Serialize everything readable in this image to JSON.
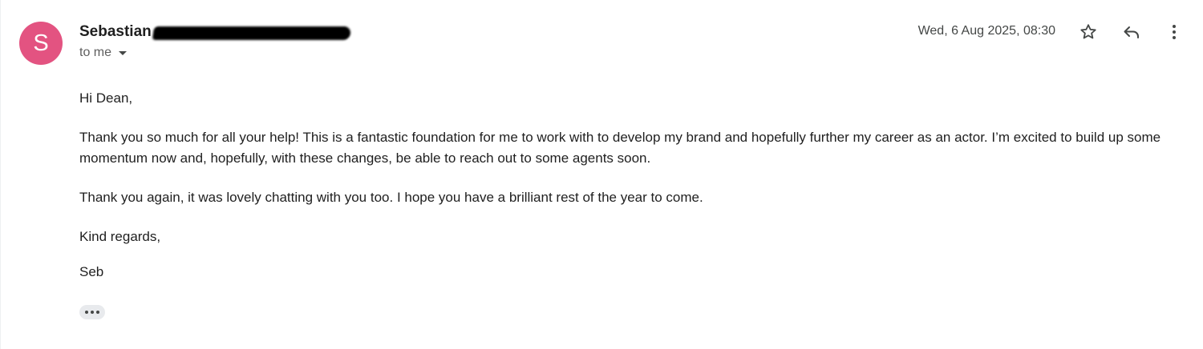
{
  "sender": {
    "avatar_letter": "S",
    "avatar_color": "#e35381",
    "name": "Sebastian"
  },
  "recipient": {
    "label": "to me"
  },
  "date": "Wed, 6 Aug 2025, 08:30",
  "actions": {
    "star_icon": "star-outline-icon",
    "reply_icon": "reply-arrow-icon",
    "more_icon": "vertical-dots-icon"
  },
  "message": {
    "greeting": "Hi Dean,",
    "paragraph_1": "Thank you so much for all your help! This is a fantastic foundation for me to work with to develop my brand and hopefully further my career as an actor. I’m excited to build up some momentum now and, hopefully, with these changes, be able to reach out to some agents soon.",
    "paragraph_2": "Thank you again, it was lovely chatting with you too. I hope you have a brilliant rest of the year to come.",
    "closing": "Kind regards,",
    "signature": "Seb"
  }
}
